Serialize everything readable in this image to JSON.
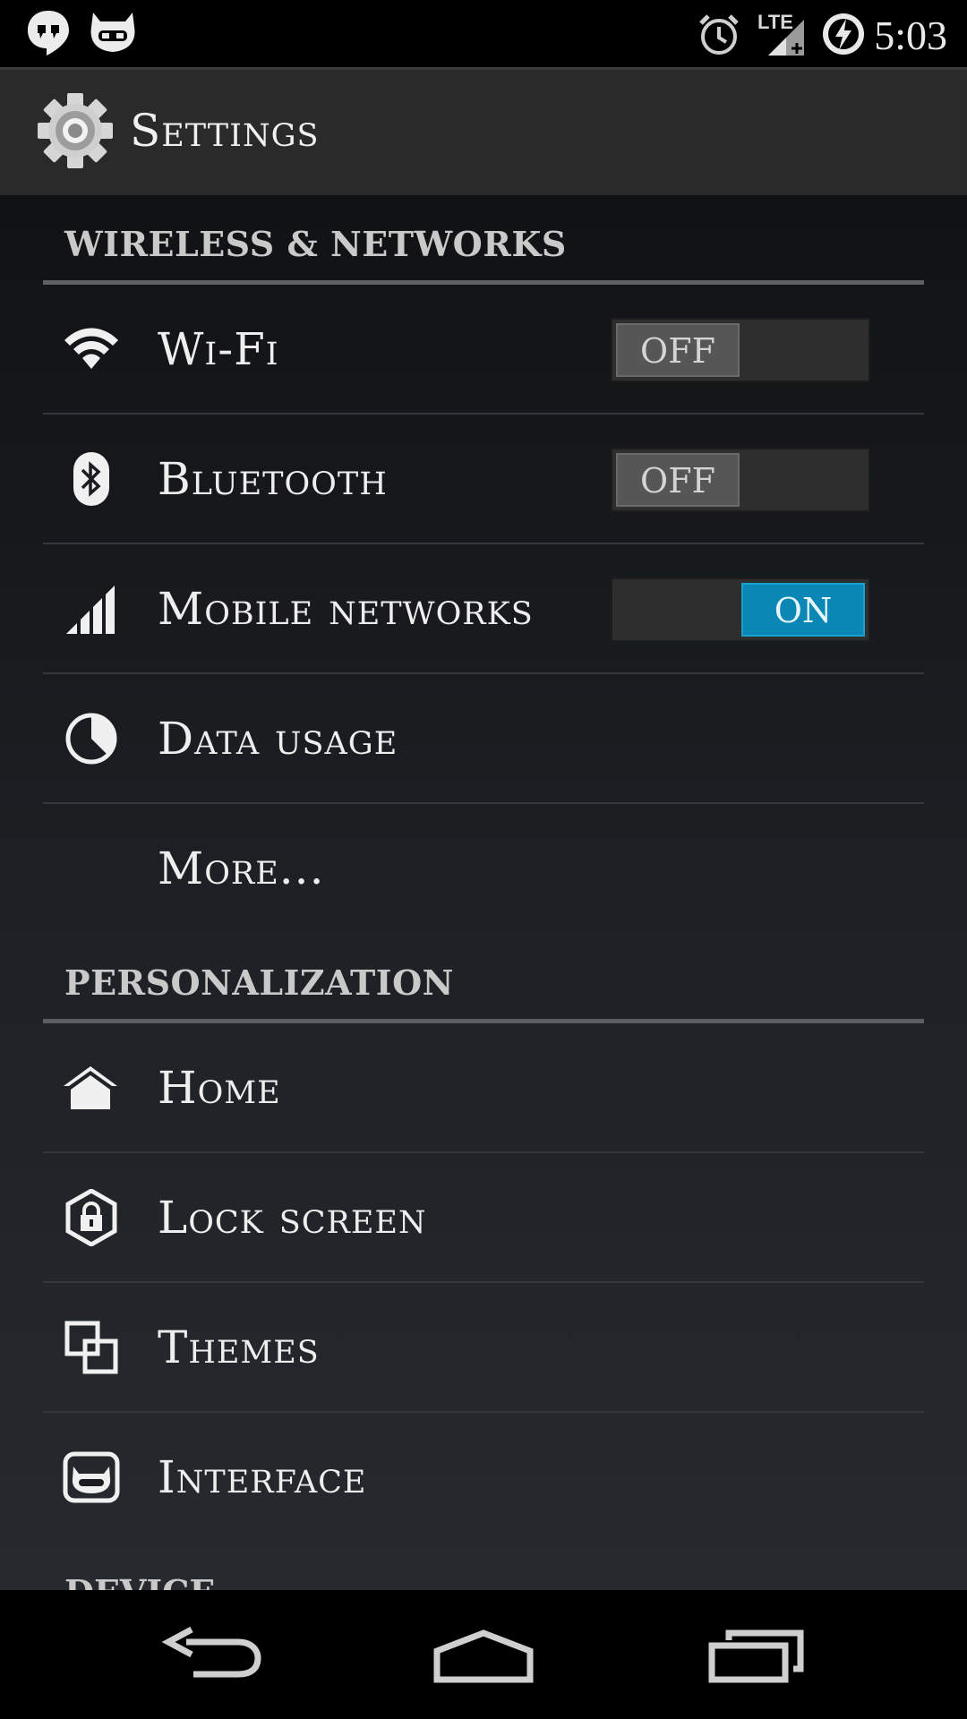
{
  "status_bar": {
    "time": "5:03",
    "network_type": "LTE",
    "icons": [
      "hangouts-icon",
      "cyanogenmod-icon",
      "alarm-icon",
      "lte-signal-icon",
      "battery-charging-icon"
    ]
  },
  "action_bar": {
    "title": "Settings",
    "icon": "gear-icon"
  },
  "sections": [
    {
      "header": "WIRELESS & NETWORKS",
      "items": [
        {
          "label": "Wi-Fi",
          "icon": "wifi-icon",
          "toggle": "OFF"
        },
        {
          "label": "Bluetooth",
          "icon": "bluetooth-icon",
          "toggle": "OFF"
        },
        {
          "label": "Mobile networks",
          "icon": "signal-icon",
          "toggle": "ON"
        },
        {
          "label": "Data usage",
          "icon": "data-usage-icon"
        },
        {
          "label": "More..."
        }
      ]
    },
    {
      "header": "PERSONALIZATION",
      "items": [
        {
          "label": "Home",
          "icon": "home-icon"
        },
        {
          "label": "Lock screen",
          "icon": "lock-icon"
        },
        {
          "label": "Themes",
          "icon": "themes-icon"
        },
        {
          "label": "Interface",
          "icon": "interface-icon"
        }
      ]
    },
    {
      "header": "DEVICE"
    }
  ],
  "nav_bar": {
    "buttons": [
      "back-icon",
      "home-nav-icon",
      "recents-icon"
    ]
  },
  "colors": {
    "accent_on": "#0a87b5",
    "toggle_off": "#565656",
    "action_bar": "#2a2a2a",
    "divider": "#34373b"
  }
}
